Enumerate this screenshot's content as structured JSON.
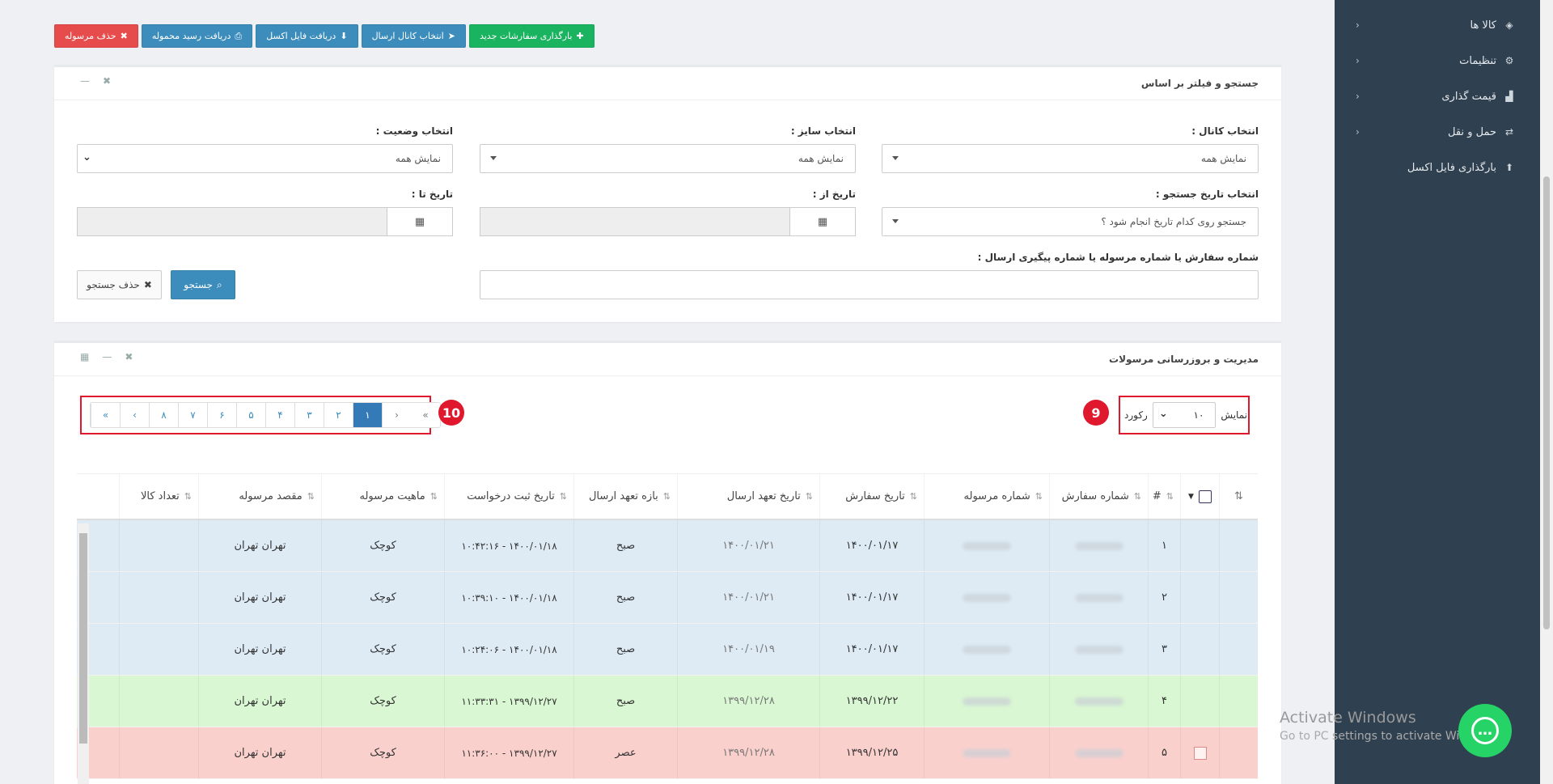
{
  "toolbar": {
    "delete": "حذف مرسوله",
    "receipt": "دریافت رسید محموله",
    "excel": "دریافت فایل اکسل",
    "channel": "انتخاب کانال ارسال",
    "upload": "بارگذاری سفارشات جدید"
  },
  "sidebar": {
    "items": [
      {
        "label": "کالا ها",
        "icon": "cubes-icon",
        "glyph": "◈"
      },
      {
        "label": "تنظیمات",
        "icon": "gear-icon",
        "glyph": "⚙"
      },
      {
        "label": "قیمت گذاری",
        "icon": "chart-area-icon",
        "glyph": "▟"
      },
      {
        "label": "حمل و نقل",
        "icon": "exchange-icon",
        "glyph": "⇄"
      },
      {
        "label": "بارگذاری فایل اکسل",
        "icon": "upload-icon",
        "glyph": "⬆"
      }
    ]
  },
  "filter": {
    "title": "جستجو و فیلتر بر اساس",
    "channel_label": "انتخاب کانال :",
    "channel_value": "نمایش همه",
    "size_label": "انتخاب سایز :",
    "size_value": "نمایش همه",
    "status_label": "انتخاب وضعیت :",
    "status_value": "نمایش همه",
    "datetype_label": "انتخاب تاریخ جستجو :",
    "datetype_value": "جستجو روی کدام تاریخ انجام شود ؟",
    "from_label": "تاریخ از :",
    "to_label": "تاریخ تا :",
    "order_label": "شماره سفارش یا شماره مرسوله یا شماره پیگیری ارسال :",
    "search_button": "جستجو",
    "clear_button": "حذف جستجو"
  },
  "manage": {
    "title": "مدیریت و بروزرسانی مرسولات",
    "show_label": "نمایش",
    "rows_value": "۱۰",
    "record_label": "رکورد",
    "badge_rows": "9",
    "badge_pager": "10",
    "pager": [
      "»",
      "‹",
      "۱",
      "۲",
      "۳",
      "۴",
      "۵",
      "۶",
      "۷",
      "۸",
      "›",
      "»"
    ]
  },
  "table": {
    "headers": [
      "#",
      "شماره سفارش",
      "شماره مرسوله",
      "تاریخ سفارش",
      "تاریخ تعهد ارسال",
      "بازه تعهد ارسال",
      "تاریخ ثبت درخواست",
      "ماهیت مرسوله",
      "مقصد مرسوله",
      "تعداد کالا"
    ],
    "rows": [
      {
        "num": "۱",
        "order_date": "۱۴۰۰/۰۱/۱۷",
        "commit_date": "۱۴۰۰/۰۱/۲۱",
        "slot": "صبح",
        "reg": "۱۴۰۰/۰۱/۱۸ - ۱۰:۴۲:۱۶",
        "kind": "کوچک",
        "dest": "تهران تهران",
        "color": "blue"
      },
      {
        "num": "۲",
        "order_date": "۱۴۰۰/۰۱/۱۷",
        "commit_date": "۱۴۰۰/۰۱/۲۱",
        "slot": "صبح",
        "reg": "۱۴۰۰/۰۱/۱۸ - ۱۰:۳۹:۱۰",
        "kind": "کوچک",
        "dest": "تهران تهران",
        "color": "blue"
      },
      {
        "num": "۳",
        "order_date": "۱۴۰۰/۰۱/۱۷",
        "commit_date": "۱۴۰۰/۰۱/۱۹",
        "slot": "صبح",
        "reg": "۱۴۰۰/۰۱/۱۸ - ۱۰:۲۴:۰۶",
        "kind": "کوچک",
        "dest": "تهران تهران",
        "color": "blue"
      },
      {
        "num": "۴",
        "order_date": "۱۳۹۹/۱۲/۲۲",
        "commit_date": "۱۳۹۹/۱۲/۲۸",
        "slot": "صبح",
        "reg": "۱۳۹۹/۱۲/۲۷ - ۱۱:۳۳:۳۱",
        "kind": "کوچک",
        "dest": "تهران تهران",
        "color": "green"
      },
      {
        "num": "۵",
        "order_date": "۱۳۹۹/۱۲/۲۵",
        "commit_date": "۱۳۹۹/۱۲/۲۸",
        "slot": "عصر",
        "reg": "۱۳۹۹/۱۲/۲۷ - ۱۱:۳۶:۰۰",
        "kind": "کوچک",
        "dest": "تهران تهران",
        "color": "red"
      }
    ]
  },
  "watermark": {
    "line1": "Activate Windows",
    "line2": "Go to PC settings to activate Windows."
  }
}
